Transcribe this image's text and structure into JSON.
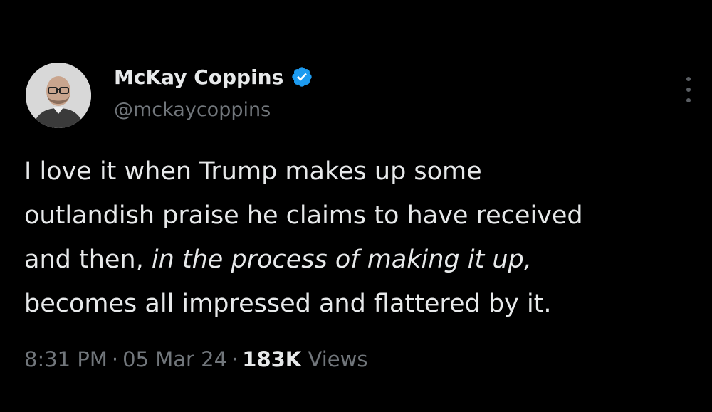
{
  "author": {
    "display_name": "McKay Coppins",
    "handle": "@mckaycoppins",
    "verified": true,
    "verified_color": "#1d9bf0"
  },
  "tweet": {
    "lines": [
      {
        "plain": "I love it when Trump makes up some",
        "italic": ""
      },
      {
        "plain": "outlandish praise he claims to have received",
        "italic": ""
      },
      {
        "plain": "and then, ",
        "italic": "in the process of making it up,"
      },
      {
        "plain": "becomes all impressed and flattered by it.",
        "italic": ""
      }
    ]
  },
  "meta": {
    "time": "8:31 PM",
    "date": "05 Mar 24",
    "separator": "·",
    "views_count": "183K",
    "views_label": "Views"
  },
  "icons": {
    "avatar": "avatar-photo",
    "verified": "verified-badge-icon",
    "more": "more-options-icon"
  },
  "colors": {
    "background": "#000000",
    "text_primary": "#e7e9ea",
    "text_secondary": "#71767b"
  }
}
